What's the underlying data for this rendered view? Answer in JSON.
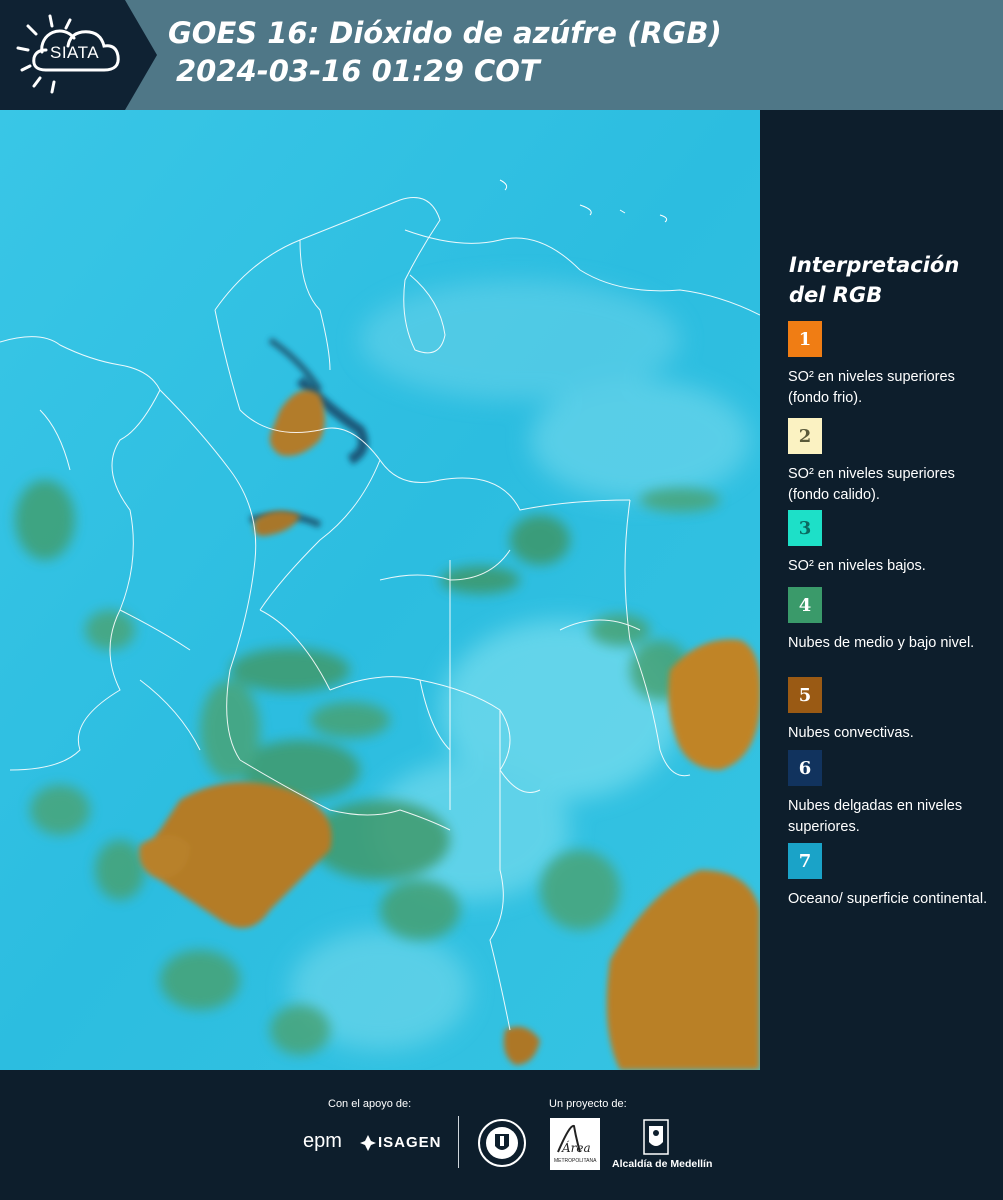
{
  "header": {
    "logo_text": "SIATA",
    "title_line1": "GOES 16: Dióxido de azúfre (RGB)",
    "title_line2": "2024-03-16 01:29 COT",
    "logo_icon": "sun-cloud-icon",
    "colors": {
      "left_block": "#0f2233",
      "right_block": "#4f7787"
    }
  },
  "map": {
    "image_type": "satellite-rgb",
    "colors": {
      "ocean_surface": "#2bbfe0",
      "mid_low_clouds": "#3a9a6a",
      "convective": "#b97d23",
      "thin_upper": "#123a5a",
      "borders": "#ffffff"
    }
  },
  "legend": {
    "title_line1": "Interpretación",
    "title_line2": "del RGB",
    "items": [
      {
        "number": "1",
        "label": "SO² en niveles superiores (fondo frio).",
        "color": "#f07d14",
        "text_color": "#ffffff"
      },
      {
        "number": "2",
        "label": "SO² en niveles superiores (fondo calido).",
        "color": "#fbf2c2",
        "text_color": "#5a5a3a"
      },
      {
        "number": "3",
        "label": "SO² en niveles bajos.",
        "color": "#1de0c8",
        "text_color": "#0a6a60"
      },
      {
        "number": "4",
        "label": "Nubes de medio y bajo nivel.",
        "color": "#3a9a6a",
        "text_color": "#ffffff"
      },
      {
        "number": "5",
        "label": "Nubes convectivas.",
        "color": "#9a5a14",
        "text_color": "#ffffff"
      },
      {
        "number": "6",
        "label": "Nubes delgadas en niveles superiores.",
        "color": "#11335e",
        "text_color": "#ffffff"
      },
      {
        "number": "7",
        "label": "Oceano/ superficie continental.",
        "color": "#1aa3c8",
        "text_color": "#ffffff"
      }
    ]
  },
  "footer": {
    "support_label": "Con el apoyo de:",
    "project_label": "Un proyecto de:",
    "sponsors": [
      "epm",
      "ISAGEN"
    ],
    "metro_logo_text": "Área",
    "metro_logo_sub": "METROPOLITANA",
    "alcaldia": "Alcaldía de Medellín"
  }
}
